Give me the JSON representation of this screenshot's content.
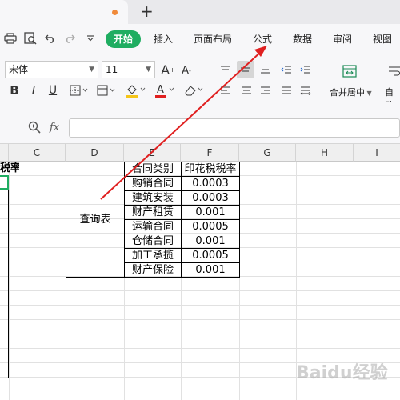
{
  "menu": {
    "active": "开始",
    "items": [
      "插入",
      "页面布局",
      "公式",
      "数据",
      "审阅",
      "视图"
    ]
  },
  "ribbon": {
    "font_name": "宋体",
    "font_size": "11",
    "merge_label": "合并居中",
    "auto_label": "自动"
  },
  "columns": [
    "C",
    "D",
    "E",
    "F",
    "G",
    "H",
    "I"
  ],
  "sheet": {
    "partial_header": "税率",
    "lookup_title": "查询表",
    "table_headers": [
      "合同类别",
      "印花税税率"
    ],
    "rows": [
      {
        "type": "购销合同",
        "rate": "0.0003"
      },
      {
        "type": "建筑安装",
        "rate": "0.0003"
      },
      {
        "type": "财产租赁",
        "rate": "0.001"
      },
      {
        "type": "运输合同",
        "rate": "0.0005"
      },
      {
        "type": "仓储合同",
        "rate": "0.001"
      },
      {
        "type": "加工承揽",
        "rate": "0.0005"
      },
      {
        "type": "财产保险",
        "rate": "0.001"
      }
    ]
  },
  "colors": {
    "accent": "#1fad61",
    "arrow": "#e02020"
  },
  "watermark": "Baidu经验"
}
